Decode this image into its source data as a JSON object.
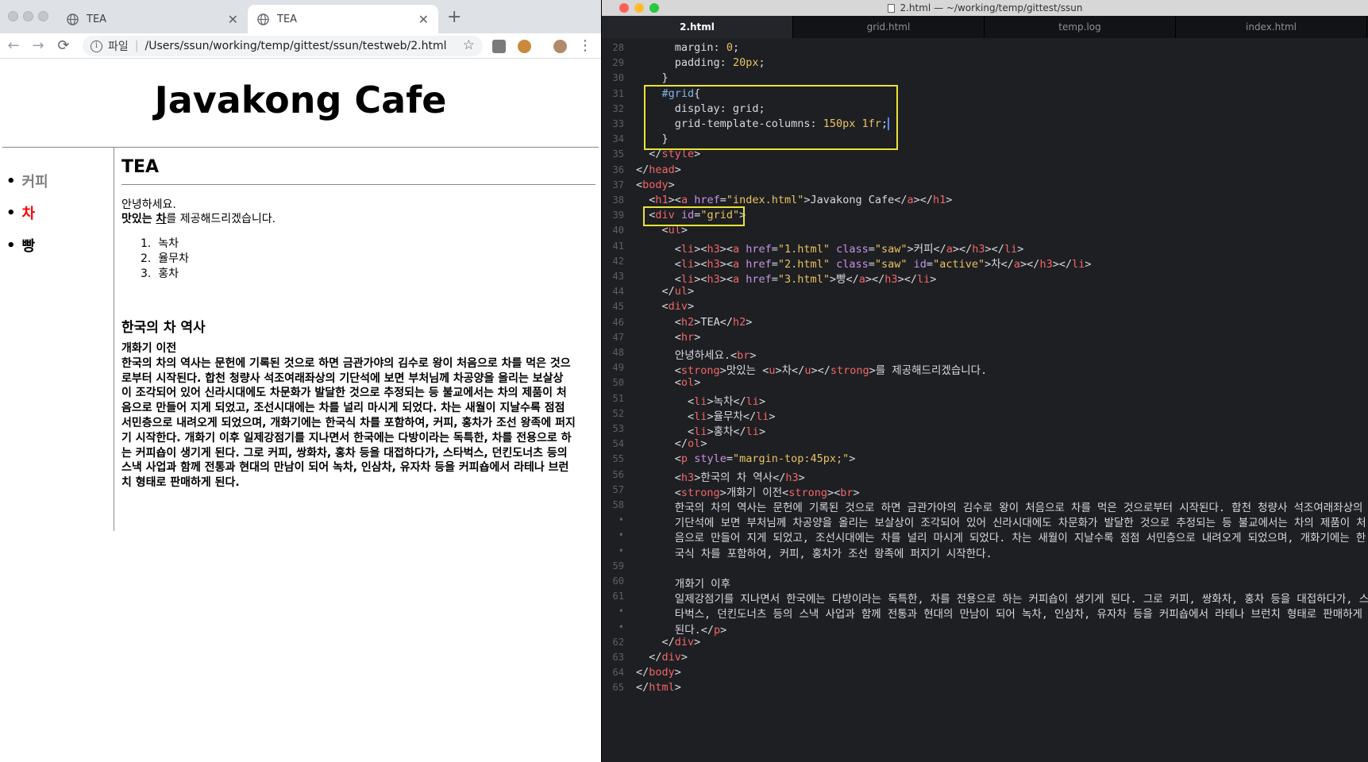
{
  "browser": {
    "tabs": [
      {
        "title": "TEA",
        "active": false
      },
      {
        "title": "TEA",
        "active": true
      }
    ],
    "new_tab": "+",
    "address": {
      "protocol_label": "파일",
      "url": "/Users/ssun/working/temp/gittest/ssun/testweb/2.html"
    },
    "nav": {
      "back": "←",
      "forward": "→",
      "reload": "⟳",
      "star": "☆",
      "menu": "⋮"
    }
  },
  "page": {
    "title": "Javakong Cafe",
    "nav_items": [
      {
        "label": "커피",
        "color": "#808080"
      },
      {
        "label": "차",
        "color": "#ff0000"
      },
      {
        "label": "빵",
        "color": "#000000"
      }
    ],
    "heading": "TEA",
    "greeting": "안녕하세요.",
    "serve_prefix": "맛있는",
    "serve_tea": "차",
    "serve_suffix": "를 제공해드리겠습니다.",
    "list": [
      "녹차",
      "율무차",
      "홍차"
    ],
    "section_title": "한국의 차 역사",
    "sub_title": "개화기 이전",
    "paragraph_lines": [
      "한국의 차의 역사는 문헌에 기록된 것으로 하면 금관가야의 김수로 왕이 처음으로 차를 먹은 것으",
      "로부터 시작된다. 합천 청량사 석조여래좌상의 기단석에 보면 부처님께 차공양을 올리는 보살상",
      "이 조각되어 있어 신라시대에도 차문화가 발달한 것으로 추정되는 등 불교에서는 차의 제품이 처",
      "음으로 만들어 지게 되었고, 조선시대에는 차를 널리 마시게 되었다. 차는 새월이 지날수록 점점",
      "서민층으로 내려오게 되었으며, 개화기에는 한국식 차를 포함하여, 커피, 홍차가 조선 왕족에 퍼지",
      "기 시작한다. 개화기 이후 일제강점기를 지나면서 한국에는 다방이라는 독특한, 차를 전용으로 하",
      "는 커피숍이 생기게 된다. 그로 커피, 쌍화차, 홍차 등을 대접하다가, 스타벅스, 던킨도너츠 등의",
      "스낵 사업과 함께 전통과 현대의 만남이 되어 녹차, 인삼차, 유자차 등을 커피숍에서 라테나 브런",
      "치 형태로 판매하게 된다."
    ]
  },
  "editor": {
    "window_title": "2.html — ~/working/temp/gittest/ssun",
    "tabs": [
      "2.html",
      "grid.html",
      "temp.log",
      "index.html"
    ],
    "active_tab": "2.html",
    "accent": "#e9e33a",
    "lines": [
      {
        "n": "28",
        "ind": "      ",
        "t": [
          [
            "",
            "margin: "
          ],
          [
            "p",
            "0"
          ],
          [
            "",
            ";"
          ]
        ]
      },
      {
        "n": "29",
        "ind": "      ",
        "t": [
          [
            "",
            "padding: "
          ],
          [
            "p",
            "20px"
          ],
          [
            "",
            ";"
          ]
        ]
      },
      {
        "n": "30",
        "ind": "    ",
        "t": [
          [
            "",
            "}"
          ]
        ]
      },
      {
        "n": "31",
        "ind": "    ",
        "t": [
          [
            "id",
            "#grid"
          ],
          [
            "",
            "{"
          ]
        ]
      },
      {
        "n": "32",
        "ind": "      ",
        "t": [
          [
            "",
            "display: grid;"
          ]
        ]
      },
      {
        "n": "33",
        "ind": "      ",
        "t": [
          [
            "",
            "grid-template-columns: "
          ],
          [
            "p",
            "150px 1fr"
          ],
          [
            "",
            ";"
          ]
        ],
        "caret": true
      },
      {
        "n": "34",
        "ind": "    ",
        "t": [
          [
            "",
            "}"
          ]
        ]
      },
      {
        "n": "35",
        "ind": "  ",
        "t": [
          [
            "",
            "</"
          ],
          [
            "k",
            "style"
          ],
          [
            "",
            ">"
          ]
        ]
      },
      {
        "n": "36",
        "ind": "",
        "t": [
          [
            "",
            "</"
          ],
          [
            "k",
            "head"
          ],
          [
            "",
            ">"
          ]
        ]
      },
      {
        "n": "37",
        "ind": "",
        "t": [
          [
            "",
            "<"
          ],
          [
            "k",
            "body"
          ],
          [
            "",
            ">"
          ]
        ]
      },
      {
        "n": "38",
        "ind": "  ",
        "t": [
          [
            "",
            "<"
          ],
          [
            "k",
            "h1"
          ],
          [
            "",
            "><"
          ],
          [
            "k",
            "a"
          ],
          [
            "",
            " "
          ],
          [
            "a",
            "href"
          ],
          [
            "",
            "="
          ],
          [
            "s",
            "\"index.html\""
          ],
          [
            "",
            ">Javakong Cafe</"
          ],
          [
            "k",
            "a"
          ],
          [
            "",
            "></"
          ],
          [
            "k",
            "h1"
          ],
          [
            "",
            ">"
          ]
        ]
      },
      {
        "n": "39",
        "ind": "  ",
        "t": [
          [
            "",
            "<"
          ],
          [
            "k",
            "div"
          ],
          [
            "",
            " "
          ],
          [
            "a",
            "id"
          ],
          [
            "",
            "="
          ],
          [
            "s",
            "\"grid\""
          ],
          [
            "",
            ">"
          ]
        ]
      },
      {
        "n": "40",
        "ind": "    ",
        "t": [
          [
            "",
            "<"
          ],
          [
            "k",
            "ul"
          ],
          [
            "",
            ">"
          ]
        ]
      },
      {
        "n": "41",
        "ind": "      ",
        "t": [
          [
            "",
            "<"
          ],
          [
            "k",
            "li"
          ],
          [
            "",
            "><"
          ],
          [
            "k",
            "h3"
          ],
          [
            "",
            "><"
          ],
          [
            "k",
            "a"
          ],
          [
            "",
            " "
          ],
          [
            "a",
            "href"
          ],
          [
            "",
            "="
          ],
          [
            "s",
            "\"1.html\""
          ],
          [
            "",
            " "
          ],
          [
            "a",
            "class"
          ],
          [
            "",
            "="
          ],
          [
            "s",
            "\"saw\""
          ],
          [
            "",
            ">커피</"
          ],
          [
            "k",
            "a"
          ],
          [
            "",
            "></"
          ],
          [
            "k",
            "h3"
          ],
          [
            "",
            "></"
          ],
          [
            "k",
            "li"
          ],
          [
            "",
            ">"
          ]
        ]
      },
      {
        "n": "42",
        "ind": "      ",
        "t": [
          [
            "",
            "<"
          ],
          [
            "k",
            "li"
          ],
          [
            "",
            "><"
          ],
          [
            "k",
            "h3"
          ],
          [
            "",
            "><"
          ],
          [
            "k",
            "a"
          ],
          [
            "",
            " "
          ],
          [
            "a",
            "href"
          ],
          [
            "",
            "="
          ],
          [
            "s",
            "\"2.html\""
          ],
          [
            "",
            " "
          ],
          [
            "a",
            "class"
          ],
          [
            "",
            "="
          ],
          [
            "s",
            "\"saw\""
          ],
          [
            "",
            " "
          ],
          [
            "a",
            "id"
          ],
          [
            "",
            "="
          ],
          [
            "s",
            "\"active\""
          ],
          [
            "",
            ">차</"
          ],
          [
            "k",
            "a"
          ],
          [
            "",
            "></"
          ],
          [
            "k",
            "h3"
          ],
          [
            "",
            "></"
          ],
          [
            "k",
            "li"
          ],
          [
            "",
            ">"
          ]
        ]
      },
      {
        "n": "43",
        "ind": "      ",
        "t": [
          [
            "",
            "<"
          ],
          [
            "k",
            "li"
          ],
          [
            "",
            "><"
          ],
          [
            "k",
            "h3"
          ],
          [
            "",
            "><"
          ],
          [
            "k",
            "a"
          ],
          [
            "",
            " "
          ],
          [
            "a",
            "href"
          ],
          [
            "",
            "="
          ],
          [
            "s",
            "\"3.html\""
          ],
          [
            "",
            ">빵</"
          ],
          [
            "k",
            "a"
          ],
          [
            "",
            "></"
          ],
          [
            "k",
            "h3"
          ],
          [
            "",
            "></"
          ],
          [
            "k",
            "li"
          ],
          [
            "",
            ">"
          ]
        ]
      },
      {
        "n": "44",
        "ind": "    ",
        "t": [
          [
            "",
            "</"
          ],
          [
            "k",
            "ul"
          ],
          [
            "",
            ">"
          ]
        ]
      },
      {
        "n": "45",
        "ind": "    ",
        "t": [
          [
            "",
            "<"
          ],
          [
            "k",
            "div"
          ],
          [
            "",
            ">"
          ]
        ]
      },
      {
        "n": "46",
        "ind": "      ",
        "t": [
          [
            "",
            "<"
          ],
          [
            "k",
            "h2"
          ],
          [
            "",
            ">TEA</"
          ],
          [
            "k",
            "h2"
          ],
          [
            "",
            ">"
          ]
        ]
      },
      {
        "n": "47",
        "ind": "      ",
        "t": [
          [
            "",
            "<"
          ],
          [
            "k",
            "hr"
          ],
          [
            "",
            ">"
          ]
        ]
      },
      {
        "n": "48",
        "ind": "      ",
        "t": [
          [
            "",
            "안녕하세요.<"
          ],
          [
            "k",
            "br"
          ],
          [
            "",
            ">"
          ]
        ]
      },
      {
        "n": "49",
        "ind": "      ",
        "t": [
          [
            "",
            "<"
          ],
          [
            "k",
            "strong"
          ],
          [
            "",
            ">맛있는 <"
          ],
          [
            "k",
            "u"
          ],
          [
            "",
            ">차</"
          ],
          [
            "k",
            "u"
          ],
          [
            "",
            "></"
          ],
          [
            "k",
            "strong"
          ],
          [
            "",
            ">를 제공해드리겠습니다."
          ]
        ]
      },
      {
        "n": "50",
        "ind": "      ",
        "t": [
          [
            "",
            "<"
          ],
          [
            "k",
            "ol"
          ],
          [
            "",
            ">"
          ]
        ]
      },
      {
        "n": "51",
        "ind": "        ",
        "t": [
          [
            "",
            "<"
          ],
          [
            "k",
            "li"
          ],
          [
            "",
            ">녹차</"
          ],
          [
            "k",
            "li"
          ],
          [
            "",
            ">"
          ]
        ]
      },
      {
        "n": "52",
        "ind": "        ",
        "t": [
          [
            "",
            "<"
          ],
          [
            "k",
            "li"
          ],
          [
            "",
            ">율무차</"
          ],
          [
            "k",
            "li"
          ],
          [
            "",
            ">"
          ]
        ]
      },
      {
        "n": "53",
        "ind": "        ",
        "t": [
          [
            "",
            "<"
          ],
          [
            "k",
            "li"
          ],
          [
            "",
            ">홍차</"
          ],
          [
            "k",
            "li"
          ],
          [
            "",
            ">"
          ]
        ]
      },
      {
        "n": "54",
        "ind": "      ",
        "t": [
          [
            "",
            "</"
          ],
          [
            "k",
            "ol"
          ],
          [
            "",
            ">"
          ]
        ]
      },
      {
        "n": "55",
        "ind": "      ",
        "t": [
          [
            "",
            "<"
          ],
          [
            "k",
            "p"
          ],
          [
            "",
            " "
          ],
          [
            "a",
            "style"
          ],
          [
            "",
            "="
          ],
          [
            "s",
            "\"margin-top:45px;\""
          ],
          [
            "",
            ">"
          ]
        ]
      },
      {
        "n": "56",
        "ind": "      ",
        "t": [
          [
            "",
            "<"
          ],
          [
            "k",
            "h3"
          ],
          [
            "",
            ">한국의 차 역사</"
          ],
          [
            "k",
            "h3"
          ],
          [
            "",
            ">"
          ]
        ]
      },
      {
        "n": "57",
        "ind": "      ",
        "t": [
          [
            "",
            "<"
          ],
          [
            "k",
            "strong"
          ],
          [
            "",
            ">개화기 이전<"
          ],
          [
            "k",
            "strong"
          ],
          [
            "",
            "><"
          ],
          [
            "k",
            "br"
          ],
          [
            "",
            ">"
          ]
        ]
      },
      {
        "n": "58",
        "ind": "      ",
        "t": [
          [
            "",
            "한국의 차의 역사는 문헌에 기록된 것으로 하면 금관가야의 김수로 왕이 처음으로 차를 먹은 것으로부터 시작된다. 합천 청량사 석조여래좌상의"
          ]
        ]
      },
      {
        "n": "•",
        "ind": "      ",
        "t": [
          [
            "",
            "기단석에 보면 부처님께 차공양을 올리는 보살상이 조각되어 있어 신라시대에도 차문화가 발달한 것으로 추정되는 등 불교에서는 차의 제품이 처"
          ]
        ]
      },
      {
        "n": "•",
        "ind": "      ",
        "t": [
          [
            "",
            "음으로 만들어 지게 되었고, 조선시대에는 차를 널리 마시게 되었다. 차는 새월이 지날수록 점점 서민층으로 내려오게 되었으며, 개화기에는 한"
          ]
        ]
      },
      {
        "n": "•",
        "ind": "      ",
        "t": [
          [
            "",
            "국식 차를 포함하여, 커피, 홍차가 조선 왕족에 퍼지기 시작한다."
          ]
        ]
      },
      {
        "n": "59",
        "ind": "",
        "t": [
          [
            "",
            ""
          ]
        ]
      },
      {
        "n": "60",
        "ind": "      ",
        "t": [
          [
            "",
            "개화기 이후"
          ]
        ]
      },
      {
        "n": "61",
        "ind": "      ",
        "t": [
          [
            "",
            "일제강점기를 지나면서 한국에는 다방이라는 독특한, 차를 전용으로 하는 커피숍이 생기게 된다. 그로 커피, 쌍화차, 홍차 등을 대접하다가, 스"
          ]
        ]
      },
      {
        "n": "•",
        "ind": "      ",
        "t": [
          [
            "",
            "타벅스, 던킨도너츠 등의 스낵 사업과 함께 전통과 현대의 만남이 되어 녹차, 인삼차, 유자차 등을 커피숍에서 라테나 브런치 형태로 판매하게"
          ]
        ]
      },
      {
        "n": "•",
        "ind": "      ",
        "t": [
          [
            "",
            "된다.</"
          ],
          [
            "k",
            "p"
          ],
          [
            "",
            ">"
          ]
        ]
      },
      {
        "n": "62",
        "ind": "    ",
        "t": [
          [
            "",
            "</"
          ],
          [
            "k",
            "div"
          ],
          [
            "",
            ">"
          ]
        ]
      },
      {
        "n": "63",
        "ind": "  ",
        "t": [
          [
            "",
            "</"
          ],
          [
            "k",
            "div"
          ],
          [
            "",
            ">"
          ]
        ]
      },
      {
        "n": "64",
        "ind": "",
        "t": [
          [
            "",
            "</"
          ],
          [
            "k",
            "body"
          ],
          [
            "",
            ">"
          ]
        ]
      },
      {
        "n": "65",
        "ind": "",
        "t": [
          [
            "",
            "</"
          ],
          [
            "k",
            "html"
          ],
          [
            "",
            ">"
          ]
        ]
      }
    ]
  }
}
